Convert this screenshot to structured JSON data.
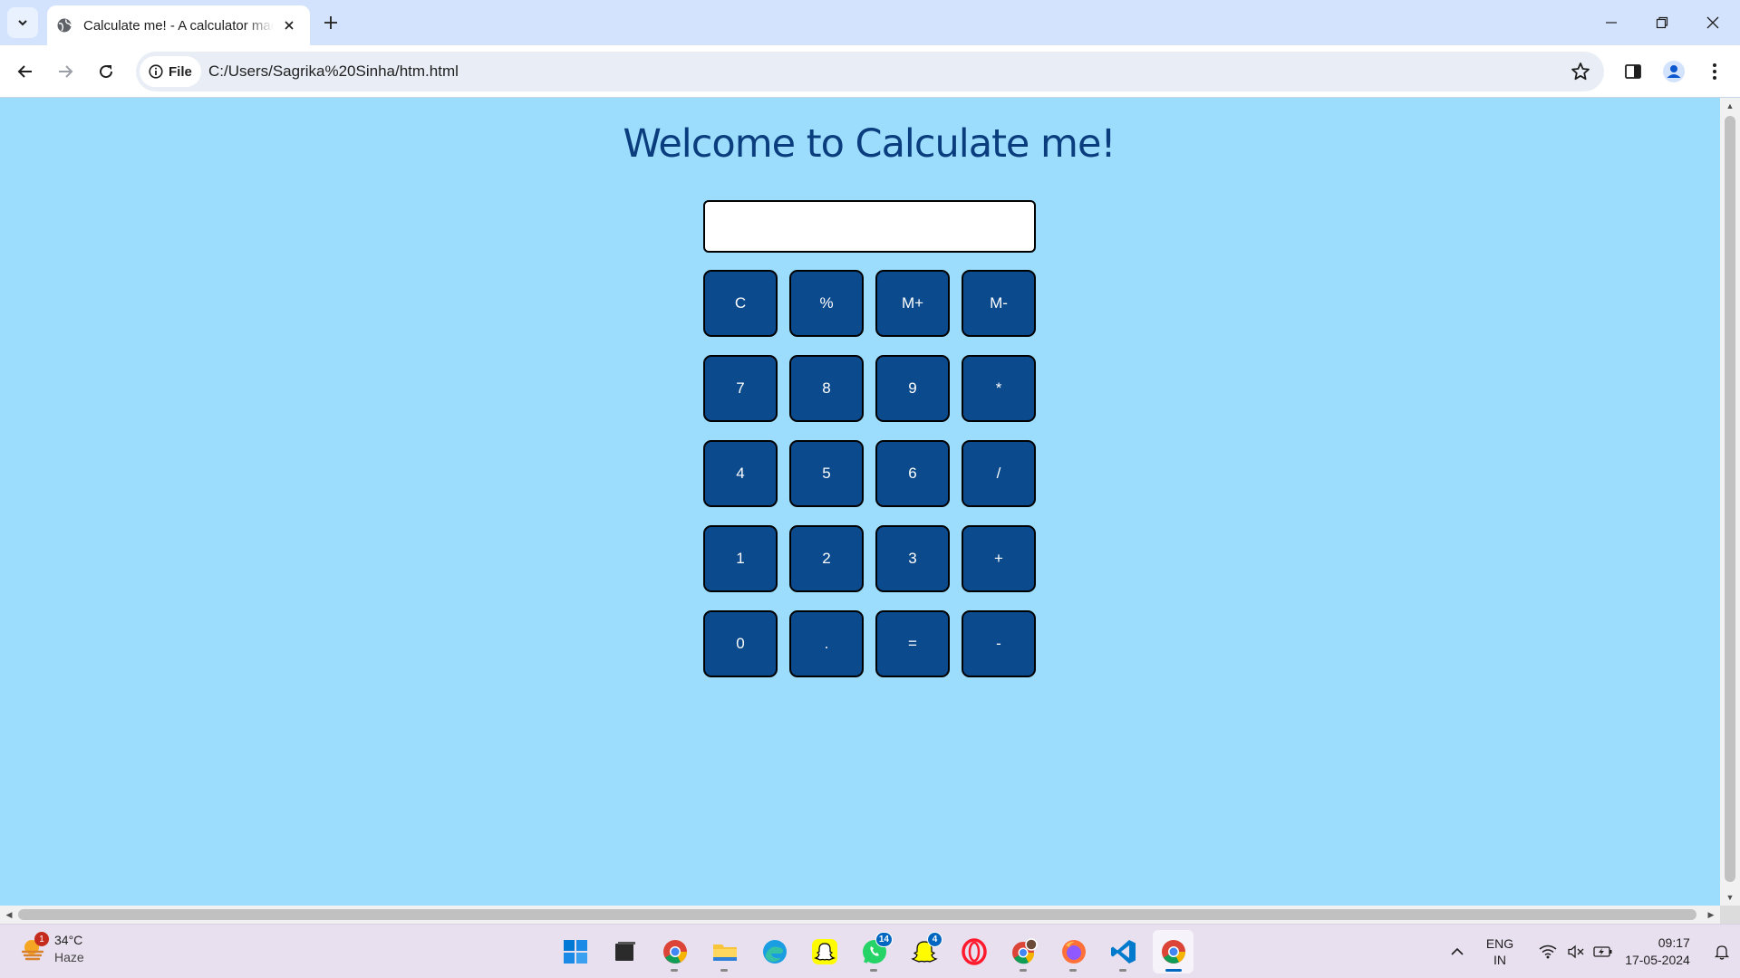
{
  "browser": {
    "tab_title": "Calculate me! - A calculator made",
    "url": "C:/Users/Sagrika%20Sinha/htm.html",
    "site_info_label": "File"
  },
  "page": {
    "heading": "Welcome to Calculate me!",
    "display_value": "",
    "keys": [
      "C",
      "%",
      "M+",
      "M-",
      "7",
      "8",
      "9",
      "*",
      "4",
      "5",
      "6",
      "/",
      "1",
      "2",
      "3",
      "+",
      "0",
      ".",
      "=",
      "-"
    ]
  },
  "colors": {
    "page_background": "#9cdcfc",
    "heading": "#0a3d7e",
    "key_background": "#0b4a8c",
    "key_text": "#ffffff"
  },
  "taskbar": {
    "weather": {
      "temperature": "34°C",
      "condition": "Haze",
      "badge": "1"
    },
    "apps": [
      {
        "name": "windows-start-icon"
      },
      {
        "name": "task-view-icon"
      },
      {
        "name": "chrome-icon"
      },
      {
        "name": "file-explorer-icon"
      },
      {
        "name": "edge-icon"
      },
      {
        "name": "snapchat-icon"
      },
      {
        "name": "whatsapp-icon",
        "badge": "14"
      },
      {
        "name": "snapchat-alt-icon",
        "badge": "4"
      },
      {
        "name": "opera-icon"
      },
      {
        "name": "chrome-profile-icon"
      },
      {
        "name": "firefox-icon"
      },
      {
        "name": "vscode-icon"
      },
      {
        "name": "chrome-active-icon",
        "active": true
      }
    ],
    "language": {
      "line1": "ENG",
      "line2": "IN"
    },
    "time": "09:17",
    "date": "17-05-2024"
  }
}
